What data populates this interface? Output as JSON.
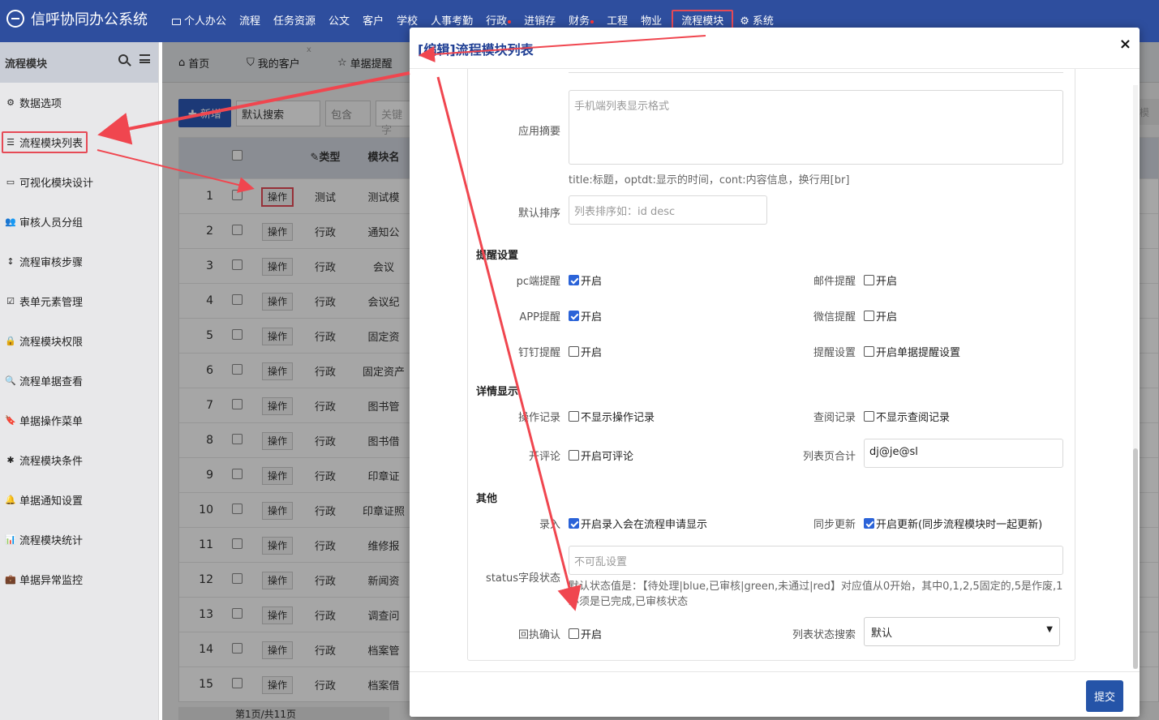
{
  "app": {
    "title": "信呼协同办公系统",
    "nav": [
      {
        "label": "个人办公",
        "icon": "monitor-icon"
      },
      {
        "label": "流程"
      },
      {
        "label": "任务资源"
      },
      {
        "label": "公文"
      },
      {
        "label": "客户"
      },
      {
        "label": "学校"
      },
      {
        "label": "人事考勤"
      },
      {
        "label": "行政",
        "dot": true
      },
      {
        "label": "进销存"
      },
      {
        "label": "财务",
        "dot": true
      },
      {
        "label": "工程"
      },
      {
        "label": "物业"
      },
      {
        "label": "流程模块",
        "active": true
      },
      {
        "label": "系统",
        "icon": "gear-icon"
      }
    ]
  },
  "sidebar": {
    "title": "流程模块",
    "items": [
      {
        "label": "数据选项",
        "icon": "gear-icon",
        "glyph": "⚙"
      },
      {
        "label": "流程模块列表",
        "icon": "list-icon",
        "glyph": "☰",
        "active": true
      },
      {
        "label": "可视化模块设计",
        "icon": "monitor-icon",
        "glyph": "▭"
      },
      {
        "label": "审核人员分组",
        "icon": "users-icon",
        "glyph": "👥"
      },
      {
        "label": "流程审核步骤",
        "icon": "vertical-arrows-icon",
        "glyph": "↕"
      },
      {
        "label": "表单元素管理",
        "icon": "checkbox-icon",
        "glyph": "☑"
      },
      {
        "label": "流程模块权限",
        "icon": "lock-icon",
        "glyph": "🔒"
      },
      {
        "label": "流程单据查看",
        "icon": "search-icon",
        "glyph": "🔍"
      },
      {
        "label": "单据操作菜单",
        "icon": "bookmark-icon",
        "glyph": "🔖"
      },
      {
        "label": "流程模块条件",
        "icon": "asterisk-icon",
        "glyph": "✱"
      },
      {
        "label": "单据通知设置",
        "icon": "bell-icon",
        "glyph": "🔔"
      },
      {
        "label": "流程模块统计",
        "icon": "bar-chart-icon",
        "glyph": "📊"
      },
      {
        "label": "单据异常监控",
        "icon": "briefcase-icon",
        "glyph": "💼"
      }
    ]
  },
  "tabs": [
    {
      "label": "首页",
      "icon": "home-icon"
    },
    {
      "label": "我的客户",
      "icon": "bookmark-icon"
    },
    {
      "label": "单据提醒",
      "icon": "star-icon"
    }
  ],
  "toolbar": {
    "new_label": "新增",
    "search_select": "默认搜索",
    "match_select": "包含",
    "keyword_placeholder": "关键字",
    "right_stub": "模"
  },
  "grid": {
    "header_type": "类型",
    "header_name": "模块名",
    "op_label": "操作",
    "rows": [
      {
        "no": "1",
        "type": "测试",
        "name": "测试模"
      },
      {
        "no": "2",
        "type": "行政",
        "name": "通知公"
      },
      {
        "no": "3",
        "type": "行政",
        "name": "会议"
      },
      {
        "no": "4",
        "type": "行政",
        "name": "会议纪"
      },
      {
        "no": "5",
        "type": "行政",
        "name": "固定资"
      },
      {
        "no": "6",
        "type": "行政",
        "name": "固定资产"
      },
      {
        "no": "7",
        "type": "行政",
        "name": "图书管"
      },
      {
        "no": "8",
        "type": "行政",
        "name": "图书借"
      },
      {
        "no": "9",
        "type": "行政",
        "name": "印章证"
      },
      {
        "no": "10",
        "type": "行政",
        "name": "印章证照"
      },
      {
        "no": "11",
        "type": "行政",
        "name": "维修报"
      },
      {
        "no": "12",
        "type": "行政",
        "name": "新闻资"
      },
      {
        "no": "13",
        "type": "行政",
        "name": "调查问"
      },
      {
        "no": "14",
        "type": "行政",
        "name": "档案管"
      },
      {
        "no": "15",
        "type": "行政",
        "name": "档案借"
      }
    ],
    "pager_text": "第1页/共11页"
  },
  "modal": {
    "title": "[编辑]流程模块列表",
    "close": "×",
    "summary_label": "应用摘要",
    "summary_placeholder": "手机端列表显示格式",
    "summary_hint": "title:标题，optdt:显示的时间，cont:内容信息，换行用[br]",
    "sort_label": "默认排序",
    "sort_placeholder": "列表排序如：id desc",
    "remind_section": "提醒设置",
    "pc_label": "pc端提醒",
    "pc_text": "开启",
    "pc_on": true,
    "mail_label": "邮件提醒",
    "mail_text": "开启",
    "mail_on": false,
    "app_label": "APP提醒",
    "app_text": "开启",
    "app_on": true,
    "wechat_label": "微信提醒",
    "wechat_text": "开启",
    "wechat_on": false,
    "ding_label": "钉钉提醒",
    "ding_text": "开启",
    "ding_on": false,
    "remindset_label": "提醒设置",
    "remindset_text": "开启单据提醒设置",
    "remindset_on": false,
    "detail_section": "详情显示",
    "oplog_label": "操作记录",
    "oplog_text": "不显示操作记录",
    "oplog_on": false,
    "viewlog_label": "查阅记录",
    "viewlog_text": "不显示查阅记录",
    "viewlog_on": false,
    "comment_label": "开评论",
    "comment_text": "开启可评论",
    "comment_on": false,
    "total_label": "列表页合计",
    "total_value": "dj@je@sl",
    "other_section": "其他",
    "entry_label": "录入",
    "entry_text": "开启录入会在流程申请显示",
    "entry_on": true,
    "sync_label": "同步更新",
    "sync_text": "开启更新(同步流程模块时一起更新)",
    "sync_on": true,
    "status_label": "status字段状态",
    "status_placeholder": "不可乱设置",
    "status_hint": "默认状态值是：【待处理|blue,已审核|green,未通过|red】对应值从0开始，其中0,1,2,5固定的,5是作废,1必须是已完成,已审核状态",
    "receipt_label": "回执确认",
    "receipt_text": "开启",
    "receipt_on": false,
    "liststatus_label": "列表状态搜索",
    "liststatus_value": "默认",
    "submit": "提交"
  },
  "colors": {
    "topbar": "#2e4e9e",
    "highlight": "#e64a56",
    "primary": "#2554a8",
    "checkbox_on": "#2b63d8"
  }
}
